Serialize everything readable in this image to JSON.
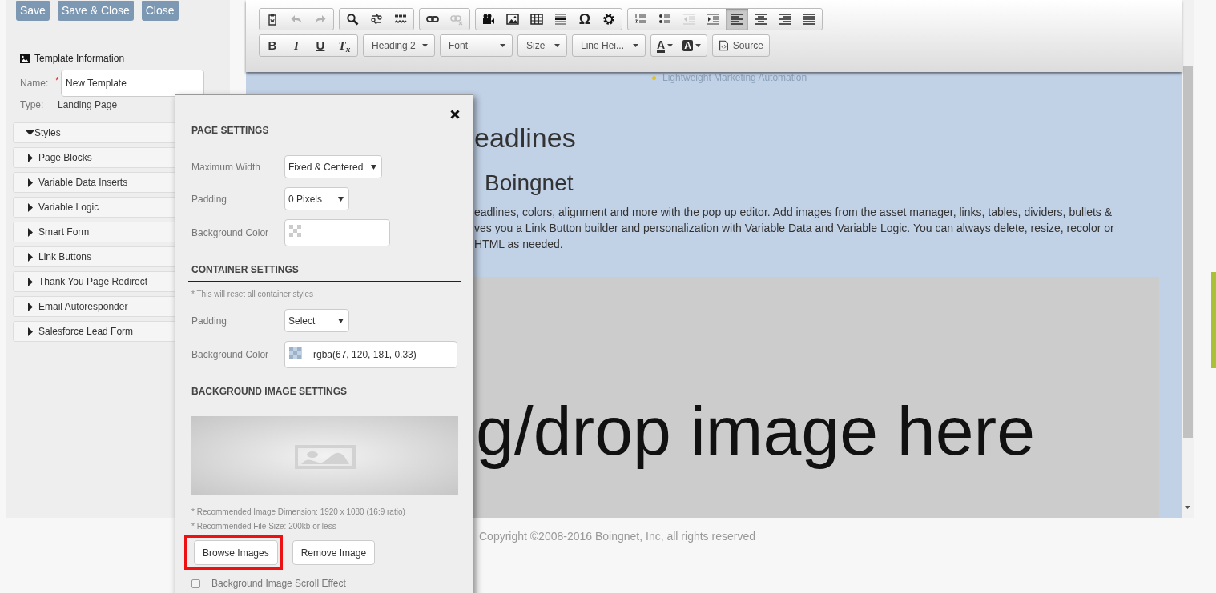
{
  "header_buttons": [
    {
      "label": "Save"
    },
    {
      "label": "Save & Close"
    },
    {
      "label": "Close"
    }
  ],
  "template_info": {
    "title": "Template Information",
    "name_label": "Name:",
    "required_mark": "*",
    "name_value": "New Template",
    "type_label": "Type:",
    "type_value": "Landing Page"
  },
  "panels": [
    {
      "label": "Styles",
      "expanded": true
    },
    {
      "label": "Page Blocks",
      "expanded": false
    },
    {
      "label": "Variable Data Inserts",
      "expanded": false
    },
    {
      "label": "Variable Logic",
      "expanded": false
    },
    {
      "label": "Smart Form",
      "expanded": false
    },
    {
      "label": "Link Buttons",
      "expanded": false
    },
    {
      "label": "Thank You Page Redirect",
      "expanded": false
    },
    {
      "label": "Email Autoresponder",
      "expanded": false
    },
    {
      "label": "Salesforce Lead Form",
      "expanded": false
    }
  ],
  "toolbar": {
    "rows": [
      {
        "groups": [
          [
            {
              "kind": "paste-word",
              "disabled": false
            },
            {
              "kind": "undo",
              "disabled": true
            },
            {
              "kind": "redo",
              "disabled": true
            }
          ],
          [
            {
              "kind": "find",
              "disabled": false
            },
            {
              "kind": "replace",
              "disabled": false
            },
            {
              "kind": "spellcheck",
              "disabled": false
            }
          ],
          [
            {
              "kind": "link",
              "disabled": false
            },
            {
              "kind": "unlink",
              "disabled": true
            }
          ],
          [
            {
              "kind": "video",
              "disabled": false
            },
            {
              "kind": "image",
              "disabled": false
            },
            {
              "kind": "table",
              "disabled": false
            },
            {
              "kind": "horizontal-rule",
              "disabled": false
            },
            {
              "kind": "special-char",
              "label": "Ω",
              "disabled": false
            },
            {
              "kind": "settings",
              "disabled": false
            }
          ],
          [
            {
              "kind": "numbered-list",
              "disabled": false
            },
            {
              "kind": "bullet-list",
              "disabled": false
            },
            {
              "kind": "outdent",
              "disabled": true
            },
            {
              "kind": "indent",
              "disabled": false
            },
            {
              "kind": "align-left",
              "disabled": false,
              "selected": true
            },
            {
              "kind": "align-center",
              "disabled": false,
              "selected": false
            },
            {
              "kind": "align-right",
              "disabled": false,
              "selected": false
            },
            {
              "kind": "justify",
              "disabled": false,
              "selected": false
            }
          ]
        ]
      },
      {
        "groups": [
          [
            {
              "kind": "bold",
              "label": "B",
              "disabled": false
            },
            {
              "kind": "italic",
              "label": "I",
              "disabled": false
            },
            {
              "kind": "underline",
              "label": "U",
              "disabled": false
            },
            {
              "kind": "clear-format",
              "label": "T$_{x}$",
              "disabled": false
            }
          ],
          [
            {
              "kind": "dropdown",
              "label": "Heading 2"
            }
          ],
          [
            {
              "kind": "dropdown",
              "label": "Font"
            }
          ],
          [
            {
              "kind": "dropdown",
              "label": "Size"
            }
          ],
          [
            {
              "kind": "dropdown",
              "label": "Line Hei..."
            }
          ],
          [
            {
              "kind": "text-color",
              "label": "A",
              "disabled": false
            },
            {
              "kind": "background-color",
              "label": "A",
              "disabled": false
            }
          ],
          [
            {
              "kind": "source",
              "label": "Source"
            }
          ]
        ]
      }
    ]
  },
  "canvas": {
    "tagline": "Lightweight Marketing Automation",
    "heading_1": "eadlines",
    "heading_2": "Boingnet",
    "paragraph_lines": [
      "eadlines, colors, alignment and more with the pop up editor. Add images from the asset manager, links, tables, dividers, bullets &",
      "ves you a Link Button builder and personalization with Variable Data and Variable Logic. You can always delete, resize, recolor or",
      "HTML as needed."
    ],
    "drop_text": "g/drop image here"
  },
  "footer": "Copyright ©2008-2016 Boingnet, Inc, all rights reserved",
  "dialog": {
    "sections": [
      {
        "title": "PAGE SETTINGS",
        "fields": [
          {
            "label": "Maximum Width",
            "kind": "select",
            "value": "Fixed & Centered"
          },
          {
            "label": "Padding",
            "kind": "select",
            "value": "0 Pixels"
          },
          {
            "label": "Background Color",
            "kind": "color"
          }
        ]
      },
      {
        "title": "CONTAINER SETTINGS",
        "note": "* This will reset all container styles",
        "fields": [
          {
            "label": "Padding",
            "kind": "select",
            "value": "Select"
          },
          {
            "label": "Background Color",
            "kind": "color",
            "value": "rgba(67, 120, 181, 0.33)"
          }
        ]
      },
      {
        "title": "BACKGROUND IMAGE SETTINGS",
        "notes": [
          "* Recommended Image Dimension: 1920 x 1080 (16:9 ratio)",
          "* Recommended File Size: 200kb or less"
        ],
        "buttons": [
          {
            "label": "Browse Images",
            "highlighted": true
          },
          {
            "label": "Remove Image",
            "highlighted": false
          }
        ],
        "checkbox": {
          "label": "Background Image Scroll Effect",
          "checked": false
        }
      }
    ]
  }
}
